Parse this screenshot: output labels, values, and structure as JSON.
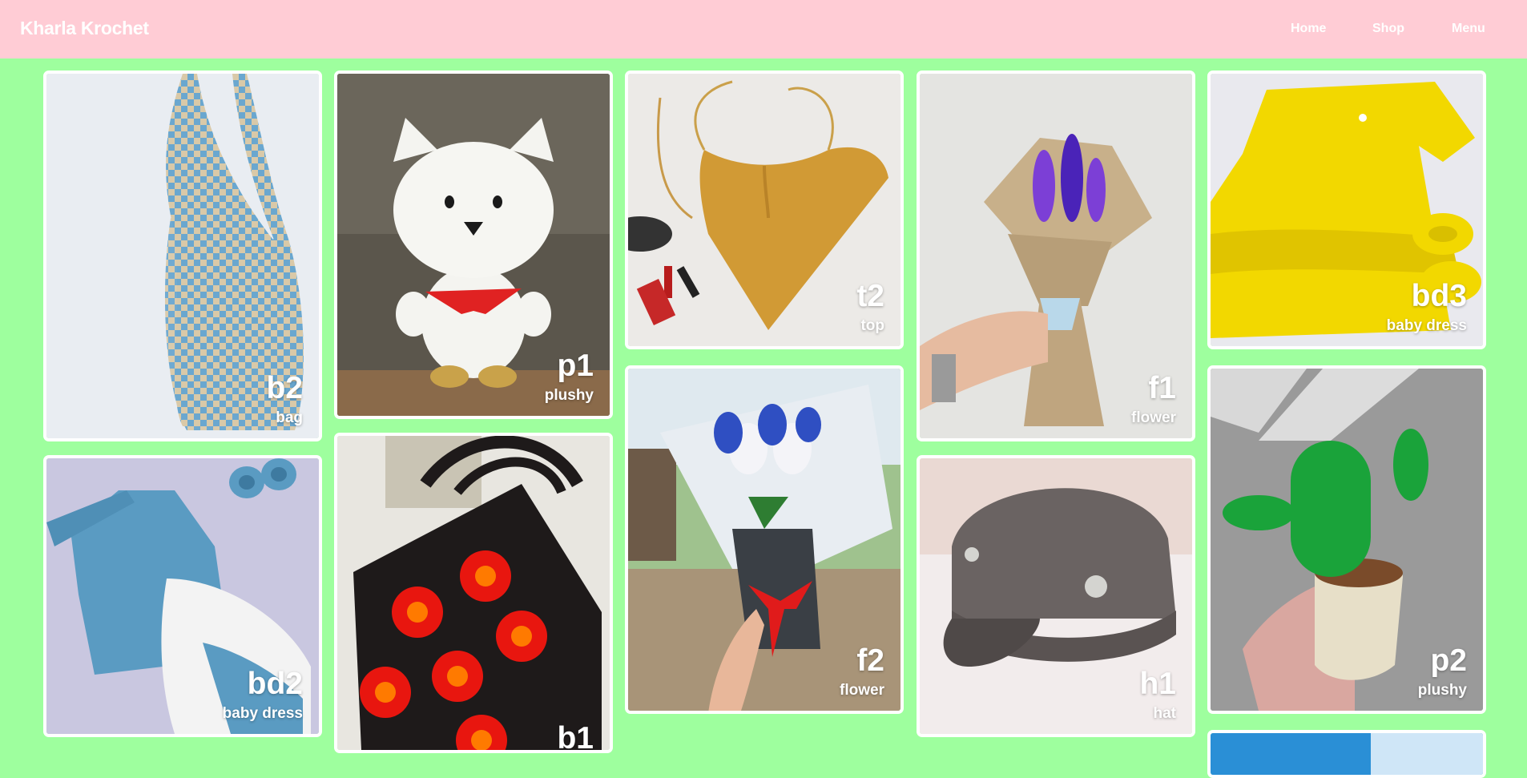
{
  "site": {
    "title": "Kharla Krochet"
  },
  "nav": {
    "items": [
      {
        "label": "Home"
      },
      {
        "label": "Shop"
      },
      {
        "label": "Menu"
      }
    ]
  },
  "colors": {
    "header": "#ffccd5",
    "page_background": "#9eff9e",
    "card_border": "#ffffff"
  },
  "products": [
    {
      "code": "b2",
      "category": "bag",
      "subject": "blue and cream checkered crochet shoulder bag"
    },
    {
      "code": "bd2",
      "category": "baby dress",
      "subject": "blue and white crochet baby dress with booties"
    },
    {
      "code": "p1",
      "category": "plushy",
      "subject": "white crochet bear with red bandana"
    },
    {
      "code": "b1",
      "category": "",
      "subject": "black crochet bag with red sunflower squares"
    },
    {
      "code": "t2",
      "category": "top",
      "subject": "mustard heart-shaped crochet halter top"
    },
    {
      "code": "f2",
      "category": "flower",
      "subject": "blue and white crochet tulip bouquet"
    },
    {
      "code": "f1",
      "category": "flower",
      "subject": "purple crochet lavender bouquet"
    },
    {
      "code": "h1",
      "category": "hat",
      "subject": "grey crochet newsboy cap"
    },
    {
      "code": "bd3",
      "category": "baby dress",
      "subject": "yellow crochet baby dress with shoes"
    },
    {
      "code": "p2",
      "category": "plushy",
      "subject": "green crochet cactus in pot"
    }
  ]
}
